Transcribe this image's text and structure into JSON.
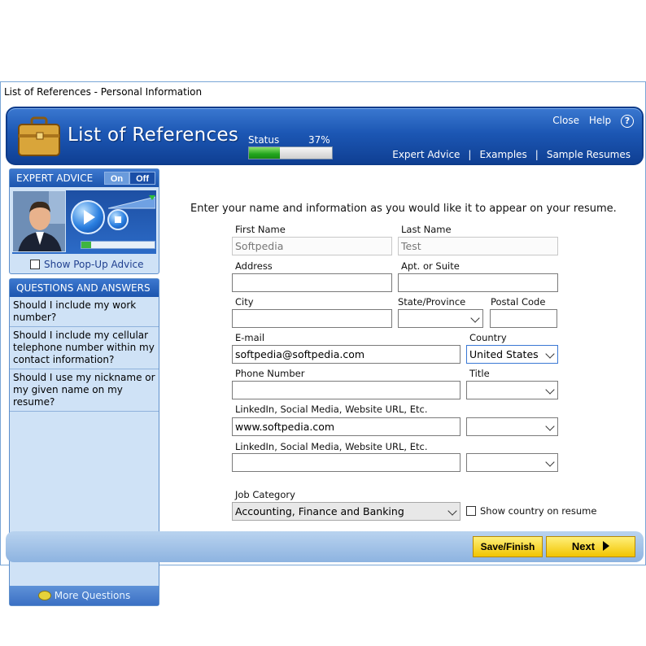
{
  "window": {
    "title": "List of References - Personal Information"
  },
  "header": {
    "title": "List of References",
    "status_label": "Status",
    "status_pct": "37%",
    "status_value": 0.37,
    "close": "Close",
    "help": "Help",
    "help_glyph": "?",
    "nav": [
      "Expert Advice",
      "Examples",
      "Sample Resumes"
    ]
  },
  "advice": {
    "title": "EXPERT ADVICE",
    "on": "On",
    "off": "Off",
    "popup_label": "Show Pop-Up Advice"
  },
  "qa": {
    "title": "QUESTIONS AND ANSWERS",
    "items": [
      "Should I include my work number?",
      "Should I include my cellular telephone number within my contact information?",
      "Should I use my nickname or my given name on my resume?"
    ],
    "more": "More Questions"
  },
  "form": {
    "instruction": "Enter your name and information as you would like it to appear on your resume.",
    "first_name_label": "First Name",
    "first_name": "Softpedia",
    "last_name_label": "Last Name",
    "last_name": "Test",
    "address_label": "Address",
    "apt_label": "Apt. or Suite",
    "city_label": "City",
    "state_label": "State/Province",
    "postal_label": "Postal Code",
    "email_label": "E-mail",
    "email": "softpedia@softpedia.com",
    "country_label": "Country",
    "country": "United States",
    "phone_label": "Phone Number",
    "title_label": "Title",
    "link1_label": "LinkedIn, Social Media, Website URL, Etc.",
    "link1": "www.softpedia.com",
    "link2_label": "LinkedIn, Social Media, Website URL, Etc.",
    "job_label": "Job Category",
    "job": "Accounting, Finance and Banking",
    "show_country": "Show country on resume"
  },
  "footer": {
    "save": "Save/Finish",
    "next": "Next"
  },
  "colors": {
    "banner": "#1c57b4",
    "button": "#f2c400",
    "panel": "#cfe2f6"
  }
}
